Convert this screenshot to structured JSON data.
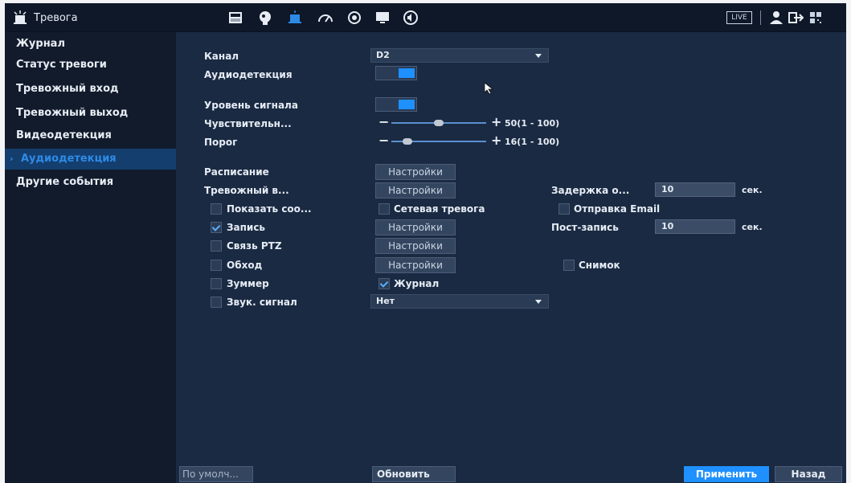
{
  "header": {
    "title": "Тревога",
    "live_label": "LIVE",
    "icons": [
      "camera-icon",
      "face-icon",
      "alarm-icon",
      "gauge-icon",
      "target-icon",
      "monitor-icon",
      "speaker-icon",
      "user-icon",
      "logout-icon",
      "qr-icon"
    ]
  },
  "sidebar": {
    "items": [
      {
        "label": "Журнал",
        "active": false
      },
      {
        "label": "Статус тревоги",
        "active": false
      },
      {
        "label": "Тревожный вход",
        "active": false
      },
      {
        "label": "Тревожный выход",
        "active": false
      },
      {
        "label": "Видеодетекция",
        "active": false
      },
      {
        "label": "Аудиодетекция",
        "active": true
      },
      {
        "label": "Другие события",
        "active": false
      }
    ]
  },
  "form": {
    "channel": {
      "label": "Канал",
      "value": "D2"
    },
    "audio_detection": {
      "label": "Аудиодетекция",
      "enabled": true
    },
    "signal_level": {
      "label": "Уровень сигнала",
      "enabled": true
    },
    "sensitivity": {
      "label": "Чувствительн...",
      "value": 50,
      "range_text": "50(1 - 100)"
    },
    "threshold": {
      "label": "Порог",
      "value": 16,
      "range_text": "16(1 - 100)"
    },
    "schedule": {
      "label": "Расписание",
      "button": "Настройки"
    },
    "alarm_out": {
      "label": "Тревожный в...",
      "button": "Настройки"
    },
    "delay": {
      "label": "Задержка о...",
      "value": "10",
      "unit": "сек."
    },
    "show_message": {
      "label": "Показать соо...",
      "checked": false
    },
    "network_alarm": {
      "label": "Сетевая тревога",
      "checked": false
    },
    "send_email": {
      "label": "Отправка Email",
      "checked": false
    },
    "record": {
      "label": "Запись",
      "checked": true,
      "button": "Настройки"
    },
    "post_record": {
      "label": "Пост-запись",
      "value": "10",
      "unit": "сек."
    },
    "ptz": {
      "label": "Связь PTZ",
      "checked": false,
      "button": "Настройки"
    },
    "tour": {
      "label": "Обход",
      "checked": false,
      "button": "Настройки"
    },
    "snapshot": {
      "label": "Снимок",
      "checked": false
    },
    "buzzer": {
      "label": "Зуммер",
      "checked": false
    },
    "log": {
      "label": "Журнал",
      "checked": true
    },
    "sound": {
      "label": "Звук. сигнал",
      "checked": false,
      "value": "Нет"
    }
  },
  "footer": {
    "default_label": "По умолч...",
    "refresh_label": "Обновить",
    "apply_label": "Применить",
    "back_label": "Назад"
  },
  "colors": {
    "accent": "#1e90ff",
    "background": "#1a2a42",
    "sidebar": "#111b2b"
  }
}
